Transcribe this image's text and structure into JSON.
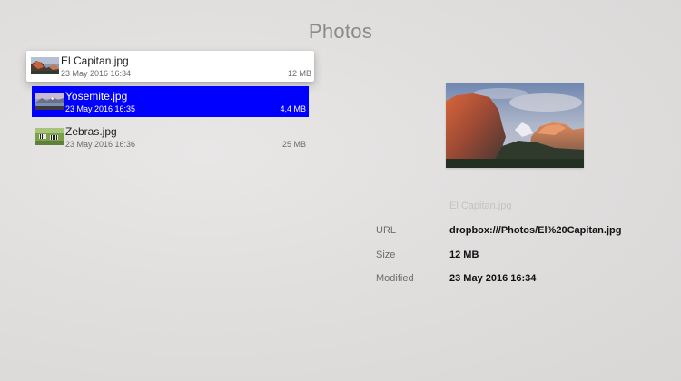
{
  "app": {
    "title": "Photos"
  },
  "files": [
    {
      "name": "El Capitan.jpg",
      "date": "23 May 2016 16:34",
      "size": "12 MB",
      "thumb_icon": "mountain-sunset-thumbnail",
      "state": "focused"
    },
    {
      "name": "Yosemite.jpg",
      "date": "23 May 2016 16:35",
      "size": "4,4 MB",
      "thumb_icon": "mountain-lake-thumbnail",
      "state": "selected"
    },
    {
      "name": "Zebras.jpg",
      "date": "23 May 2016 16:36",
      "size": "25 MB",
      "thumb_icon": "zebras-grassland-thumbnail",
      "state": "normal"
    }
  ],
  "detail": {
    "preview_icon": "el-capitan-preview-image",
    "caption": "El Capitan.jpg",
    "url_label": "URL",
    "url_value": "dropbox:///Photos/El%20Capitan.jpg",
    "size_label": "Size",
    "size_value": "12 MB",
    "modified_label": "Modified",
    "modified_value": "23 May 2016 16:34"
  },
  "colors": {
    "selection": "#0000ff",
    "title": "#8c8a89",
    "background": "#e1dfde"
  }
}
